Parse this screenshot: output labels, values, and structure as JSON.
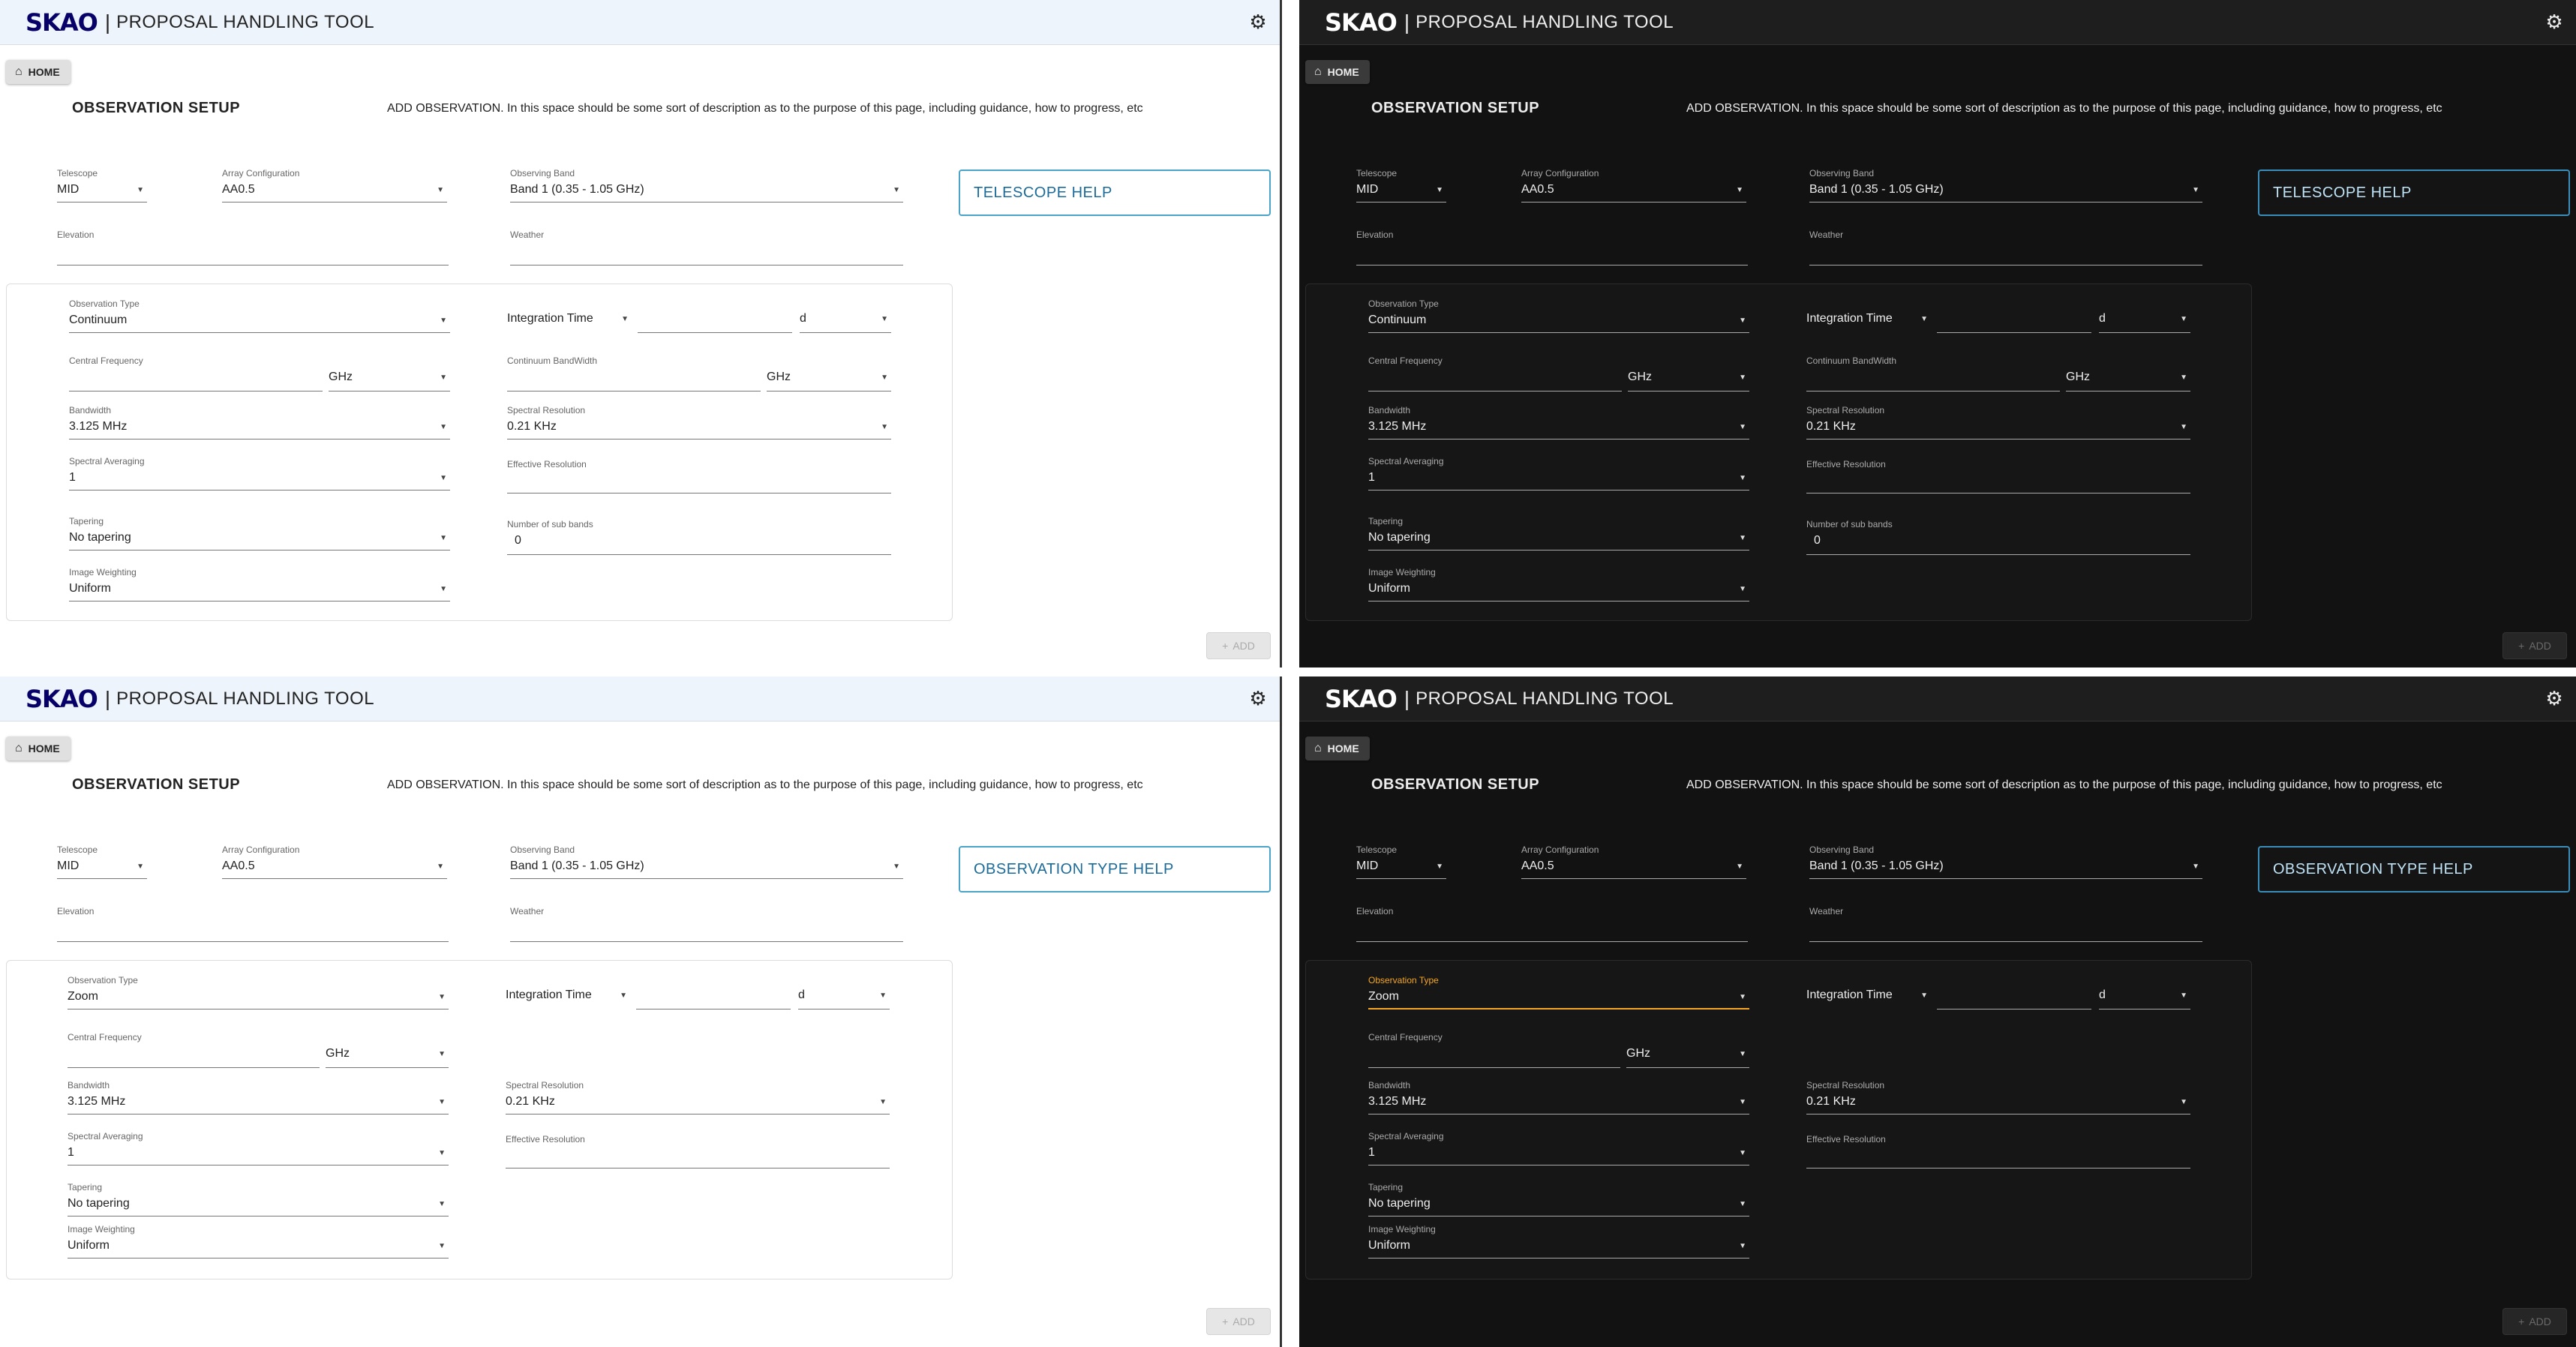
{
  "app": {
    "logo": "SKAO",
    "separator": "|",
    "title": "PROPOSAL HANDLING TOOL"
  },
  "icons": {
    "settings": "gear-icon",
    "home": "home-icon",
    "dropdown": "chevron-down-icon",
    "add": "plus-icon"
  },
  "symbols": {
    "home": "⌂",
    "settings": "⚙",
    "caret": "▼",
    "add": "+"
  },
  "home_label": "HOME",
  "page_title": "OBSERVATION SETUP",
  "description": "ADD OBSERVATION. In this space should be some sort of description as to the purpose of this page, including guidance, how to progress, etc",
  "add_label": "ADD",
  "telescope": {
    "label": "Telescope",
    "value": "MID"
  },
  "array_config": {
    "label": "Array Configuration",
    "value": "AA0.5"
  },
  "observing_band": {
    "label": "Observing Band",
    "value": "Band 1 (0.35 - 1.05 GHz)"
  },
  "elevation": {
    "label": "Elevation",
    "value": ""
  },
  "weather": {
    "label": "Weather",
    "value": ""
  },
  "integration_time": {
    "label": "Integration Time",
    "value": "",
    "unit": "d"
  },
  "central_frequency": {
    "label": "Central Frequency",
    "value": "",
    "unit": "GHz"
  },
  "continuum_bandwidth": {
    "label": "Continuum BandWidth",
    "value": "",
    "unit": "GHz"
  },
  "bandwidth": {
    "label": "Bandwidth",
    "value": "3.125 MHz"
  },
  "spectral_resolution": {
    "label": "Spectral Resolution",
    "value": "0.21 KHz"
  },
  "spectral_averaging": {
    "label": "Spectral Averaging",
    "value": "1"
  },
  "effective_resolution": {
    "label": "Effective Resolution",
    "value": ""
  },
  "tapering": {
    "label": "Tapering",
    "value": "No tapering"
  },
  "sub_bands": {
    "label": "Number of sub bands",
    "value": "0"
  },
  "image_weighting": {
    "label": "Image Weighting",
    "value": "Uniform"
  },
  "panels": [
    {
      "theme": "light",
      "help_title": "TELESCOPE HELP",
      "observation_type": {
        "label": "Observation Type",
        "value": "Continuum"
      }
    },
    {
      "theme": "dark",
      "help_title": "TELESCOPE HELP",
      "observation_type": {
        "label": "Observation Type",
        "value": "Continuum"
      }
    },
    {
      "theme": "light",
      "help_title": "OBSERVATION TYPE HELP",
      "observation_type": {
        "label": "Observation Type",
        "value": "Zoom"
      }
    },
    {
      "theme": "dark",
      "help_title": "OBSERVATION TYPE HELP",
      "observation_type": {
        "label": "Observation Type",
        "value": "Zoom"
      }
    }
  ]
}
